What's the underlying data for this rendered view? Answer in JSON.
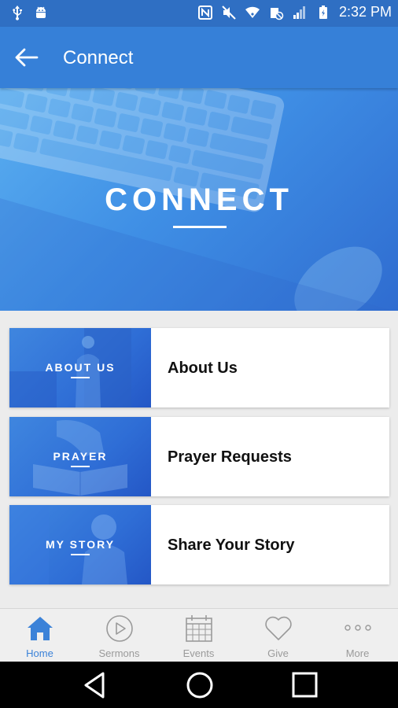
{
  "status_bar": {
    "time": "2:32 PM",
    "icons": [
      "usb-icon",
      "android-debug-icon",
      "nfc-icon",
      "mute-icon",
      "wifi-icon",
      "data-blocked-icon",
      "signal-icon",
      "battery-icon"
    ]
  },
  "app_bar": {
    "back_icon": "arrow-left-icon",
    "title": "Connect"
  },
  "hero": {
    "title": "CONNECT"
  },
  "cards": [
    {
      "thumb_label": "ABOUT US",
      "title": "About Us"
    },
    {
      "thumb_label": "PRAYER",
      "title": "Prayer Requests"
    },
    {
      "thumb_label": "MY STORY",
      "title": "Share Your Story"
    }
  ],
  "bottom_nav": {
    "items": [
      {
        "label": "Home",
        "icon": "home-icon",
        "active": true
      },
      {
        "label": "Sermons",
        "icon": "play-circle-icon",
        "active": false
      },
      {
        "label": "Events",
        "icon": "calendar-icon",
        "active": false
      },
      {
        "label": "Give",
        "icon": "heart-icon",
        "active": false
      },
      {
        "label": "More",
        "icon": "more-dots-icon",
        "active": false
      }
    ]
  },
  "system_nav": [
    "back-triangle-icon",
    "home-circle-icon",
    "recents-square-icon"
  ],
  "colors": {
    "status_bar": "#2f6fc3",
    "app_bar": "#3680d8",
    "accent": "#3b82d8",
    "nav_inactive": "#9a9a9a"
  }
}
